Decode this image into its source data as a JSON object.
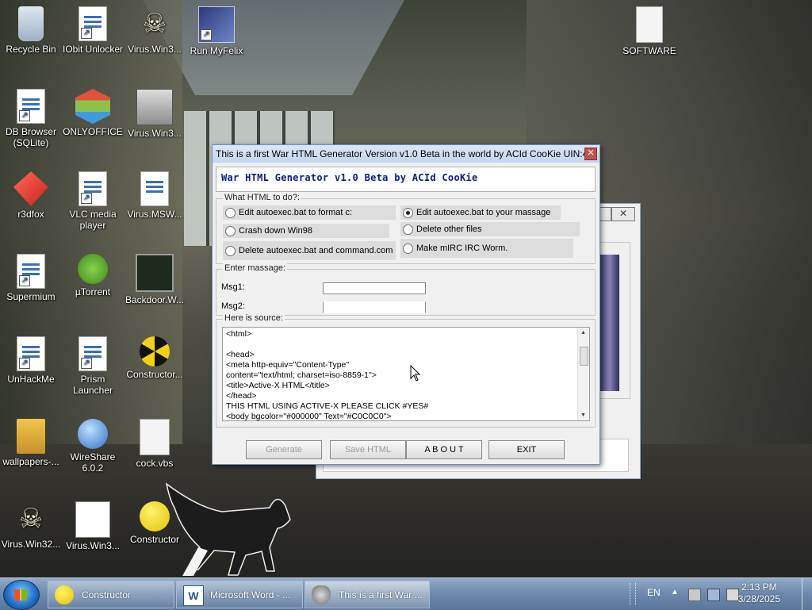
{
  "desktop": {
    "icons": [
      {
        "label": "Recycle Bin"
      },
      {
        "label": "IObit Unlocker"
      },
      {
        "label": "Virus.Win3..."
      },
      {
        "label": "Run MyFelix"
      },
      {
        "label": "DB Browser (SQLite)"
      },
      {
        "label": "ONLYOFFICE"
      },
      {
        "label": "Virus.Win3..."
      },
      {
        "label": "r3dfox"
      },
      {
        "label": "VLC media player"
      },
      {
        "label": "Virus.MSW..."
      },
      {
        "label": "Supermium"
      },
      {
        "label": "µTorrent"
      },
      {
        "label": "Backdoor.W..."
      },
      {
        "label": "UnHackMe"
      },
      {
        "label": "Prism Launcher"
      },
      {
        "label": "Constructor..."
      },
      {
        "label": "wallpapers-..."
      },
      {
        "label": "WireShare 6.0.2"
      },
      {
        "label": "cock.vbs"
      },
      {
        "label": "Virus.Win32..."
      },
      {
        "label": "Virus.Win3..."
      },
      {
        "label": "Constructor"
      },
      {
        "label": "SOFTWARE"
      }
    ]
  },
  "dialog": {
    "title": "This is a first War HTML Generator Version v1.0 Beta in the world by ACId CooKie UIN:4...",
    "close_glyph": "✕",
    "banner": "War HTML Generator v1.0 Beta by ACId CooKie",
    "group_what": "What HTML to do?:",
    "options": [
      {
        "label": "Edit autoexec.bat to format c:",
        "selected": false
      },
      {
        "label": "Edit autoexec.bat to your massage",
        "selected": true
      },
      {
        "label": "Crash down Win98",
        "selected": false
      },
      {
        "label": "Delete other files",
        "selected": false
      },
      {
        "label": "Delete autoexec.bat and command.com",
        "selected": false
      },
      {
        "label": "Make mIRC IRC Worm.",
        "selected": false
      }
    ],
    "group_msg": "Enter massage:",
    "msg1_label": "Msg1:",
    "msg1_value": "",
    "msg2_label": "Msg2:",
    "msg2_value": "",
    "group_source": "Here is source:",
    "source": "<html>\n\n<head>\n<meta http-equiv=\"Content-Type\"\ncontent=\"text/html; charset=iso-8859-1\">\n<title>Active-X HTML</title>\n</head>\nTHIS HTML USING ACTIVE-X PLEASE CLICK #YES#\n<body bgcolor=\"#000000\" Text=\"#C0C0C0\">",
    "buttons": {
      "generate": "Generate",
      "save": "Save HTML",
      "about": "A B O U T",
      "exit": "EXIT"
    }
  },
  "background_window": {
    "close_glyph": "✕"
  },
  "taskbar": {
    "items": [
      {
        "label": "Constructor"
      },
      {
        "label": "Microsoft Word - ..."
      },
      {
        "label": "This is a first War ..."
      }
    ],
    "lang": "EN",
    "time": "2:13 PM",
    "date": "3/28/2025"
  }
}
